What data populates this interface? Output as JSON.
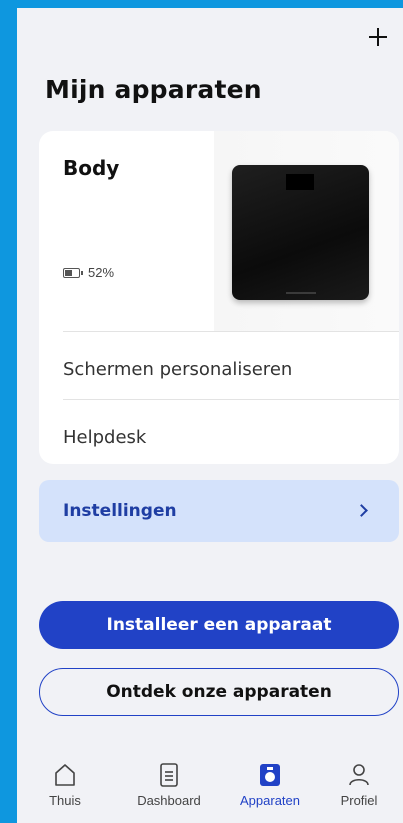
{
  "header": {
    "add_icon": "plus-icon"
  },
  "page": {
    "title": "Mijn apparaten"
  },
  "device": {
    "name": "Body",
    "battery_text": "52%",
    "battery_level": 0.52,
    "image": "scale-image"
  },
  "menu": {
    "items": [
      {
        "label": "Schermen personaliseren"
      },
      {
        "label": "Helpdesk"
      }
    ]
  },
  "settings": {
    "label": "Instellingen"
  },
  "actions": {
    "install_label": "Installeer een apparaat",
    "discover_label": "Ontdek onze apparaten"
  },
  "tabs": [
    {
      "label": "Thuis",
      "icon": "home-icon"
    },
    {
      "label": "Dashboard",
      "icon": "dashboard-icon"
    },
    {
      "label": "Apparaten",
      "icon": "devices-icon",
      "active": true
    },
    {
      "label": "Profiel",
      "icon": "profile-icon"
    }
  ],
  "colors": {
    "accent": "#2142c6",
    "settings_bg": "#d4e2fb",
    "background": "#f1f2f6",
    "frame": "#0e97df"
  }
}
